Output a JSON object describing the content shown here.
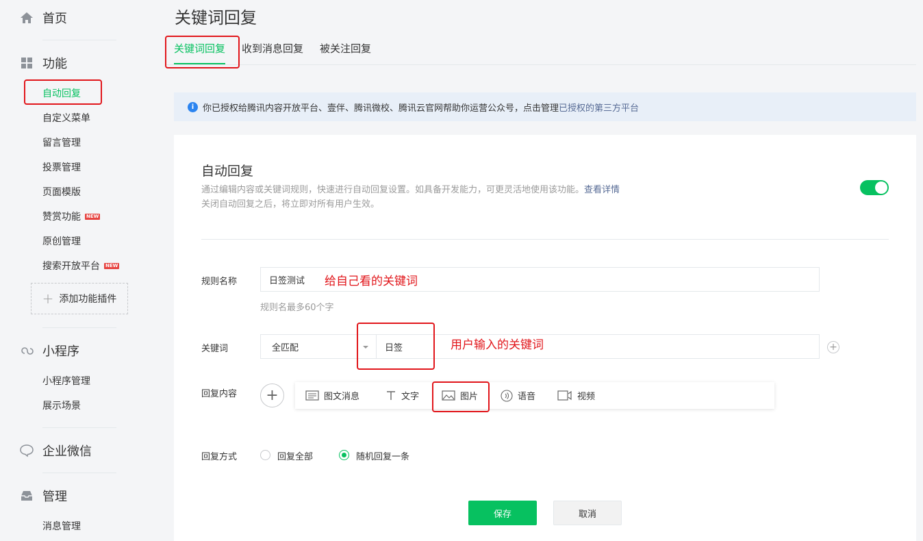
{
  "page": {
    "title": "关键词回复"
  },
  "sidebar": {
    "home": "首页",
    "features": "功能",
    "feature_items": [
      "自动回复",
      "自定义菜单",
      "留言管理",
      "投票管理",
      "页面模版",
      "赞赏功能",
      "原创管理",
      "搜索开放平台"
    ],
    "new_tag": "NEW",
    "add_plugin": "添加功能插件",
    "miniprogram": "小程序",
    "miniprogram_items": [
      "小程序管理",
      "展示场景"
    ],
    "wecom": "企业微信",
    "manage": "管理",
    "manage_items": [
      "消息管理"
    ]
  },
  "tabs": [
    "关键词回复",
    "收到消息回复",
    "被关注回复"
  ],
  "notice": {
    "text": "你已授权给腾讯内容开放平台、壹伴、腾讯微校、腾讯云官网帮助你运营公众号，点击管理",
    "link": "已授权的第三方平台"
  },
  "card": {
    "title": "自动回复",
    "desc_line1": "通过编辑内容或关键词规则，快速进行自动回复设置。如具备开发能力，可更灵活地使用该功能。",
    "desc_link": "查看详情",
    "desc_line2": "关闭自动回复之后，将立即对所有用户生效。",
    "toggle_on": true
  },
  "form": {
    "rule_name_label": "规则名称",
    "rule_name_value": "日签测试",
    "rule_name_hint": "规则名最多60个字",
    "keyword_label": "关键词",
    "match_mode": "全匹配",
    "keyword_value": "日签",
    "reply_content_label": "回复内容",
    "reply_types": [
      "图文消息",
      "文字",
      "图片",
      "语音",
      "视频"
    ],
    "reply_mode_label": "回复方式",
    "reply_mode_options": [
      "回复全部",
      "随机回复一条"
    ],
    "reply_mode_selected": "随机回复一条"
  },
  "annotations": {
    "rule_name_note": "给自己看的关键词",
    "keyword_note": "用户输入的关键词"
  },
  "buttons": {
    "save": "保存",
    "cancel": "取消"
  },
  "colors": {
    "accent": "#07c160",
    "link": "#576b95",
    "annotation": "#e1151a"
  }
}
